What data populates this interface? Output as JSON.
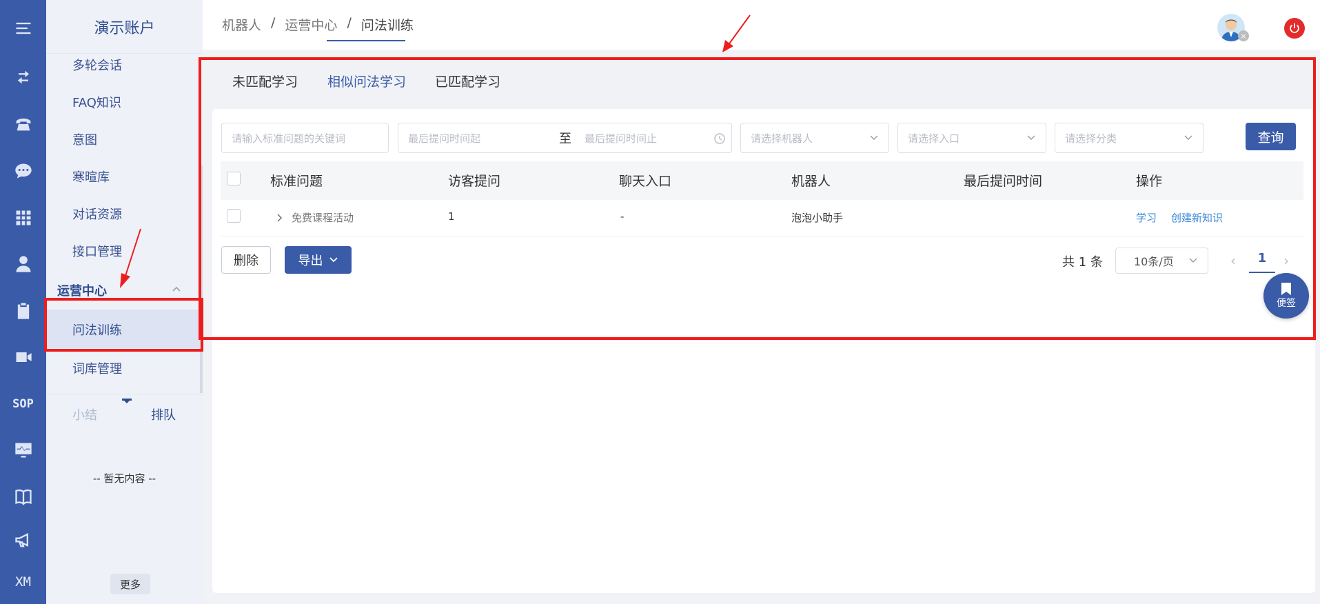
{
  "rail": {
    "items": [
      {
        "icon": "menu-icon"
      },
      {
        "icon": "transfer-icon"
      },
      {
        "icon": "phone-icon"
      },
      {
        "icon": "chat-icon"
      },
      {
        "icon": "grid-icon"
      },
      {
        "icon": "user-icon"
      },
      {
        "icon": "clipboard-icon"
      },
      {
        "icon": "video-icon"
      },
      {
        "label": "SOP"
      },
      {
        "icon": "monitor-icon"
      },
      {
        "icon": "book-icon"
      },
      {
        "icon": "megaphone-icon"
      },
      {
        "label": "XM"
      }
    ]
  },
  "sidenav": {
    "brand": "演示账户",
    "items": [
      "多轮会话",
      "FAQ知识",
      "意图",
      "寒暄库",
      "对话资源",
      "接口管理"
    ],
    "group": "运营中心",
    "active_item": "问法训练",
    "after_items": [
      "词库管理"
    ],
    "tabs": {
      "left": "小结",
      "right": "排队"
    },
    "empty": "-- 暂无内容 --",
    "more": "更多"
  },
  "breadcrumb": {
    "items": [
      "机器人",
      "运营中心",
      "问法训练"
    ],
    "sep": "/"
  },
  "tabs": {
    "items": [
      "未匹配学习",
      "相似问法学习",
      "已匹配学习"
    ],
    "active_index": 1
  },
  "filters": {
    "keyword_placeholder": "请输入标准问题的关键词",
    "date_start_placeholder": "最后提问时间起",
    "date_to": "至",
    "date_end_placeholder": "最后提问时间止",
    "robot_placeholder": "请选择机器人",
    "entry_placeholder": "请选择入口",
    "category_placeholder": "请选择分类",
    "query_label": "查询"
  },
  "table": {
    "columns": [
      "标准问题",
      "访客提问",
      "聊天入口",
      "机器人",
      "最后提问时间",
      "操作"
    ],
    "rows": [
      {
        "question": "免费课程活动",
        "visitor_asks": "1",
        "entry": "-",
        "robot": "泡泡小助手",
        "last_time": "",
        "actions": [
          "学习",
          "创建新知识"
        ]
      }
    ]
  },
  "footer": {
    "delete_label": "删除",
    "export_label": "导出",
    "total": "共 1 条",
    "page_size": "10条/页",
    "page": "1",
    "prev": "‹",
    "next": "›"
  },
  "note_button": {
    "label": "便签"
  },
  "colors": {
    "primary": "#3a5ba8",
    "highlight": "#ee1d1d",
    "link": "#3a87d8",
    "power": "#e22c2c"
  }
}
